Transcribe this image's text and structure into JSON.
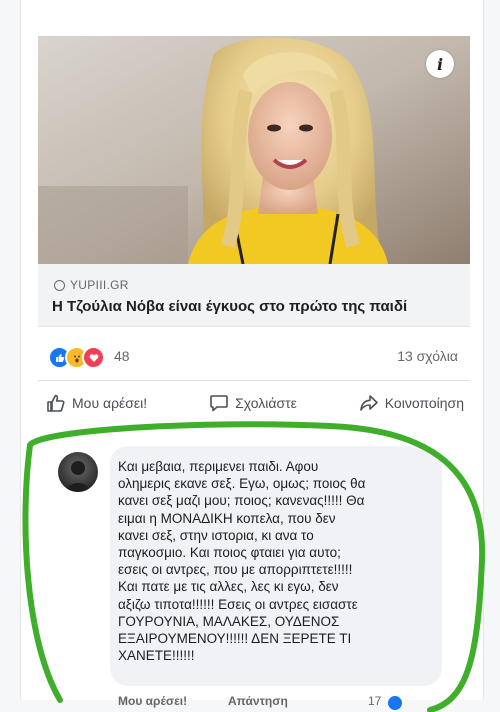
{
  "post": {
    "preview": {
      "info_icon": "i",
      "source": "YUPIII.GR",
      "headline": "Η Τζούλια Νόβα είναι έγκυος στο πρώτο της παιδί"
    },
    "reactions": {
      "count": "48",
      "comments": "13 σχόλια",
      "types": [
        "like",
        "wow",
        "love"
      ]
    },
    "actions": {
      "like": "Μου αρέσει!",
      "comment": "Σχολιάστε",
      "share": "Κοινοποίηση"
    }
  },
  "comment": {
    "text": "Και μεβαια, περιμενει παιδι. Αφου\nολημερις εκανε σεξ. Εγω, ομως; ποιος θα\nκανει σεξ μαζι μου; ποιος; κανενας!!!!! Θα\nειμαι η ΜΟΝΑΔΙΚΗ κοπελα, που δεν\nκανει σεξ, στην ιστορια, κι ανα το\nπαγκοσμιο. Και ποιος φταιει για αυτο;\nεσεις οι αντρες, που με απορριπτετε!!!!!\nΚαι πατε με τις αλλες, λες κι εγω, δεν\nαξιζω τιποτα!!!!!! Εσεις οι αντρες εισαστε\nΓΟΥΡΟΥΝΙΑ, ΜΑΛΑΚΕΣ, ΟΥΔΕΝΟΣ\nΕΞΑΙΡΟΥΜΕΝΟΥ!!!!!! ΔΕΝ ΞΕΡΕΤΕ ΤΙ\nΧΑΝΕΤΕ!!!!!!",
    "like_label": "Μου αρέσει!",
    "reply_label": "Απάντηση",
    "reaction_count": "17"
  },
  "colors": {
    "accent_blue": "#1877f2",
    "annotation_green": "#3fae2a",
    "text_primary": "#1c1e21",
    "text_secondary": "#65676b"
  }
}
